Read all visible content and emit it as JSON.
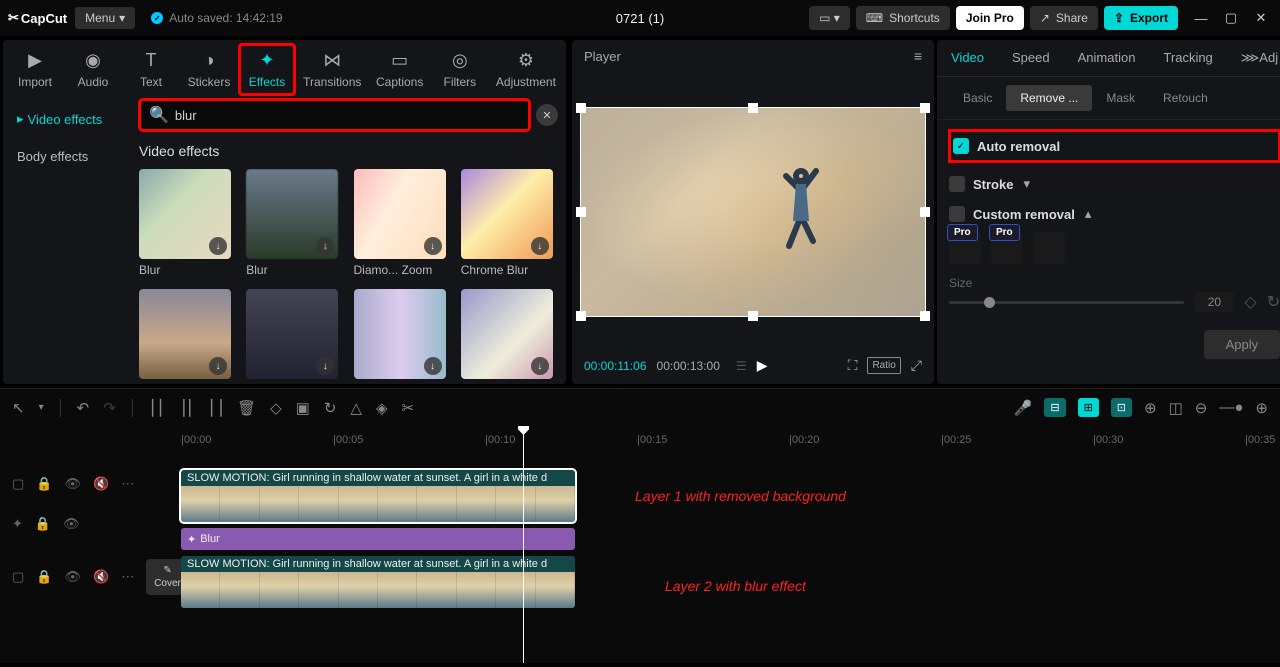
{
  "app": {
    "name": "CapCut",
    "menu": "Menu",
    "autosave": "Auto saved: 14:42:19",
    "project": "0721 (1)"
  },
  "topbar": {
    "shortcuts": "Shortcuts",
    "joinPro": "Join Pro",
    "share": "Share",
    "export": "Export"
  },
  "tabs": [
    "Import",
    "Audio",
    "Text",
    "Stickers",
    "Effects",
    "Transitions",
    "Captions",
    "Filters",
    "Adjustment"
  ],
  "effectsSidebar": {
    "video": "Video effects",
    "body": "Body effects"
  },
  "search": {
    "value": "blur"
  },
  "sectionTitle": "Video effects",
  "effects": [
    {
      "label": "Blur",
      "cls": "blur1"
    },
    {
      "label": "Blur",
      "cls": "blur2"
    },
    {
      "label": "Diamo... Zoom",
      "cls": "diamond"
    },
    {
      "label": "Chrome Blur",
      "cls": "chrome"
    },
    {
      "label": "",
      "cls": "fog"
    },
    {
      "label": "",
      "cls": "sil"
    },
    {
      "label": "",
      "cls": "glitch"
    },
    {
      "label": "",
      "cls": "motion"
    }
  ],
  "player": {
    "title": "Player",
    "current": "00:00:11:06",
    "total": "00:00:13:00",
    "ratio": "Ratio"
  },
  "rightTabs": [
    "Video",
    "Speed",
    "Animation",
    "Tracking",
    "Adj"
  ],
  "subTabs": [
    "Basic",
    "Remove ...",
    "Mask",
    "Retouch"
  ],
  "removal": {
    "auto": "Auto removal",
    "stroke": "Stroke",
    "custom": "Custom removal",
    "pro": "Pro",
    "size": "Size",
    "sizeVal": "20",
    "apply": "Apply"
  },
  "ruler": [
    "00:00",
    "00:05",
    "00:10",
    "00:15",
    "00:20",
    "00:25",
    "00:30",
    "00:35"
  ],
  "timeline": {
    "clipLabel": "SLOW MOTION: Girl running in shallow water at sunset. A girl in a white d",
    "fxLabel": "Blur",
    "cover": "Cover"
  },
  "annotations": {
    "layer1": "Layer 1 with removed background",
    "layer2": "Layer 2 with blur effect"
  }
}
